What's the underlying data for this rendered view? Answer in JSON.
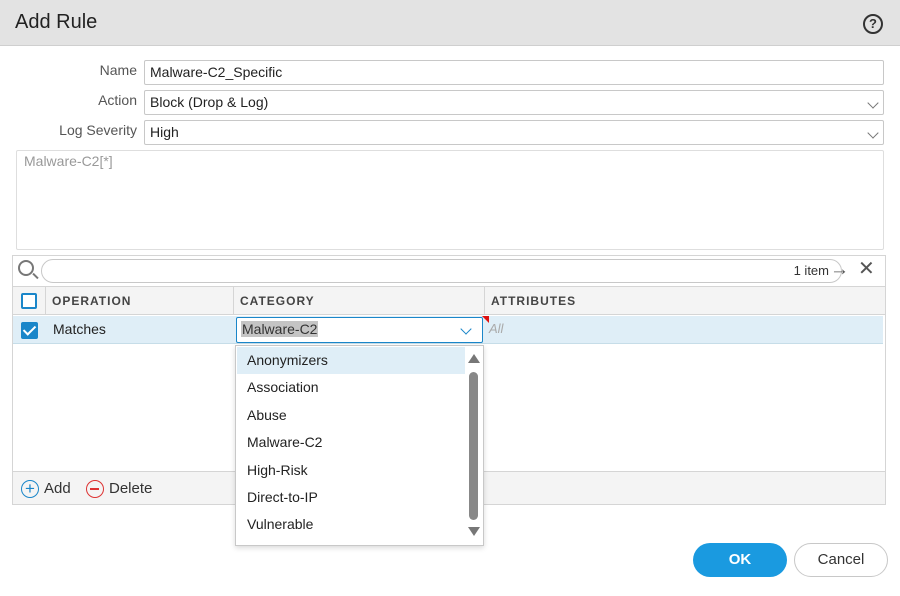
{
  "dialog": {
    "title": "Add Rule",
    "help_icon": "question-circle-icon",
    "help_glyph": "?"
  },
  "form": {
    "name_label": "Name",
    "name_value": "Malware-C2_Specific",
    "action_label": "Action",
    "action_value": "Block (Drop & Log)",
    "severity_label": "Log Severity",
    "severity_value": "High",
    "expression": "Malware-C2[*]"
  },
  "grid": {
    "item_count": "1 item",
    "columns": [
      "OPERATION",
      "CATEGORY",
      "ATTRIBUTES"
    ],
    "rows": [
      {
        "checked": true,
        "operation": "Matches",
        "category": "Malware-C2",
        "attributes": "All"
      }
    ],
    "footer": {
      "add_label": "Add",
      "delete_label": "Delete"
    }
  },
  "category_dropdown": {
    "options": [
      "Anonymizers",
      "Association",
      "Abuse",
      "Malware-C2",
      "High-Risk",
      "Direct-to-IP",
      "Vulnerable"
    ],
    "highlighted": "Anonymizers"
  },
  "buttons": {
    "ok": "OK",
    "cancel": "Cancel"
  },
  "colors": {
    "accent": "#1a9ae0",
    "row_highlight": "#dfeef7",
    "danger": "#d33"
  }
}
